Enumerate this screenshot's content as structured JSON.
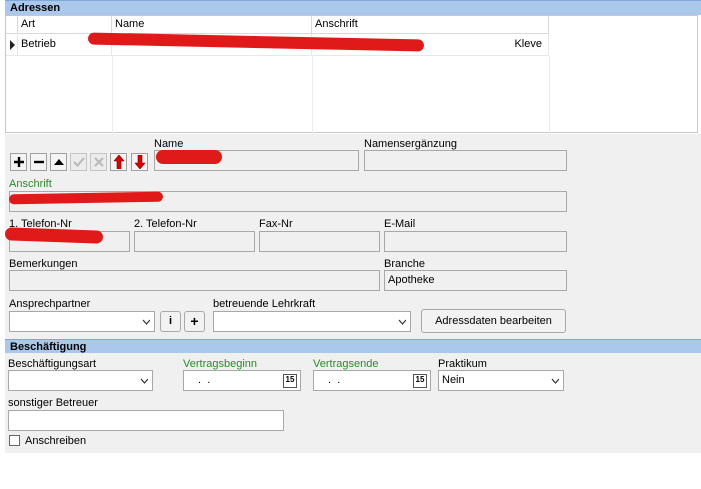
{
  "adressen": {
    "header": "Adressen",
    "columns": [
      "Art",
      "Name",
      "Anschrift"
    ],
    "rows": [
      {
        "art": "Betrieb",
        "name": "",
        "anschrift": "Kleve"
      }
    ]
  },
  "form": {
    "name_label": "Name",
    "name_value": "",
    "namensergaenzung_label": "Namensergänzung",
    "namensergaenzung_value": "",
    "anschrift_label": "Anschrift",
    "anschrift_value": "",
    "telefon1_label": "1. Telefon-Nr",
    "telefon1_value": "",
    "telefon2_label": "2. Telefon-Nr",
    "telefon2_value": "",
    "fax_label": "Fax-Nr",
    "fax_value": "",
    "email_label": "E-Mail",
    "email_value": "",
    "bemerkungen_label": "Bemerkungen",
    "bemerkungen_value": "",
    "branche_label": "Branche",
    "branche_value": "Apotheke",
    "ansprechpartner_label": "Ansprechpartner",
    "ansprechpartner_value": "",
    "info_button": "i",
    "add_button": "+",
    "lehrkraft_label": "betreuende Lehrkraft",
    "lehrkraft_value": "",
    "edit_button": "Adressdaten bearbeiten"
  },
  "beschaeftigung": {
    "header": "Beschäftigung",
    "art_label": "Beschäftigungsart",
    "art_value": "",
    "beginn_label": "Vertragsbeginn",
    "beginn_value": " .  .",
    "ende_label": "Vertragsende",
    "ende_value": " .  .",
    "calendar_icon_text": "15",
    "praktikum_label": "Praktikum",
    "praktikum_value": "Nein",
    "betreuer_label": "sonstiger Betreuer",
    "betreuer_value": "",
    "anschreiben_label": "Anschreiben"
  },
  "colors": {
    "header_bg": "#a9c8ec",
    "form_bg": "#f0f0f0",
    "label_green": "#2a8a2a",
    "arrow_red": "#e00000"
  },
  "icons": [
    "add-icon",
    "remove-icon",
    "move-up-icon",
    "check-icon",
    "cancel-icon",
    "arrow-up-red-icon",
    "arrow-down-red-icon",
    "row-pointer-icon",
    "calendar-icon",
    "chevron-down-icon"
  ]
}
